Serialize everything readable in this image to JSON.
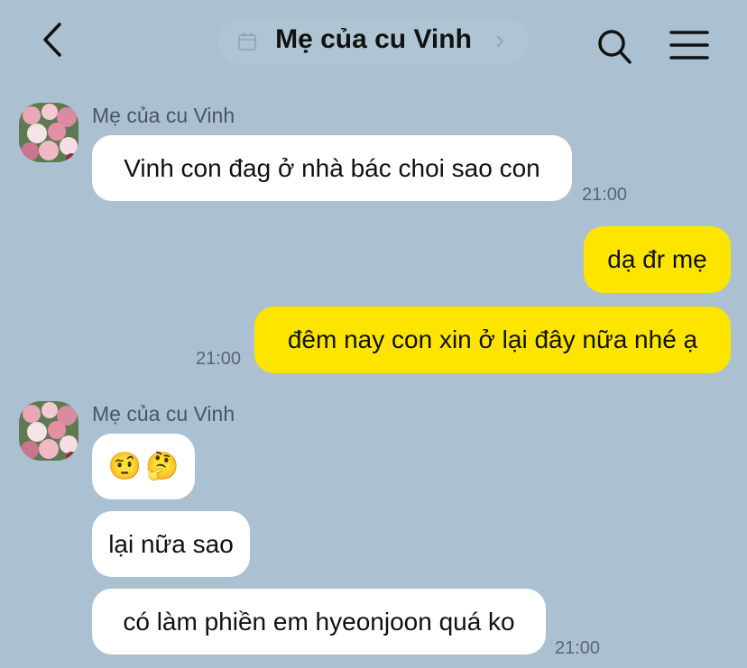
{
  "header": {
    "title": "Mẹ của cu Vinh",
    "icons": {
      "back": "chevron-left-icon",
      "calendar": "calendar-icon",
      "chevron": "chevron-right-icon",
      "search": "search-icon",
      "menu": "hamburger-menu-icon"
    }
  },
  "messages": {
    "group1": {
      "sender": "Mẹ của cu Vinh",
      "bubbles": [
        "Vinh con đag ở nhà bác choi sao con"
      ],
      "time": "21:00"
    },
    "outgoing": {
      "bubbles": [
        "dạ đr mẹ",
        "đêm nay con xin ở lại đây nữa nhé ạ"
      ],
      "time": "21:00"
    },
    "group2": {
      "sender": "Mẹ của cu Vinh",
      "emoji": [
        "🤨",
        "🤔"
      ],
      "bubbles": [
        "lại nữa sao",
        "có làm phiền em hyeonjoon quá ko"
      ],
      "time": "21:00"
    }
  },
  "colors": {
    "background": "#abc1d1",
    "incoming_bubble": "#ffffff",
    "outgoing_bubble": "#fde500"
  }
}
